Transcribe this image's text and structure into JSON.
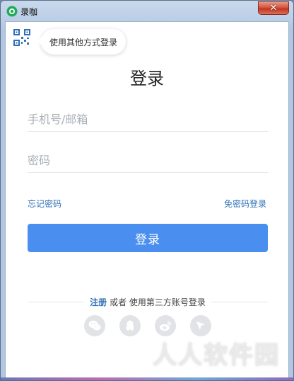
{
  "window": {
    "title": "录咖",
    "close_label": "✕"
  },
  "alt_login": {
    "bubble_text": "使用其他方式登录"
  },
  "login": {
    "heading": "登录",
    "phone_placeholder": "手机号/邮箱",
    "phone_value": "",
    "password_placeholder": "密码",
    "password_value": "",
    "forgot_label": "忘记密码",
    "passwordless_label": "免密码登录",
    "submit_label": "登录"
  },
  "footer": {
    "register_label": "注册",
    "or_text": "或者 使用第三方账号登录",
    "social": [
      {
        "icon": "wechat-icon"
      },
      {
        "icon": "qq-icon"
      },
      {
        "icon": "weibo-icon"
      },
      {
        "icon": "send-icon"
      }
    ]
  },
  "watermark": "人人软件园",
  "colors": {
    "accent": "#4a8ff0",
    "link": "#2f6fb5",
    "brand": "#1faa59"
  }
}
